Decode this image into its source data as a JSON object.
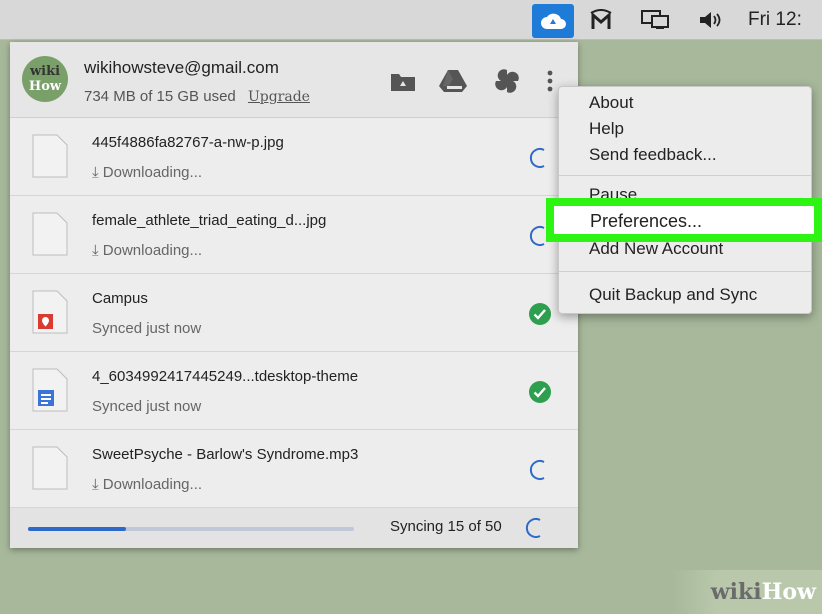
{
  "menubar": {
    "clock": "Fri 12:"
  },
  "account": {
    "avatar_line1": "wiki",
    "avatar_line2": "How",
    "email": "wikihowsteve@gmail.com",
    "usage": "734 MB of 15 GB used",
    "upgrade_label": "Upgrade"
  },
  "files": [
    {
      "name": "445f4886fa82767-a-nw-p.jpg",
      "status": "⤓ Downloading...",
      "state": "syncing"
    },
    {
      "name": "female_athlete_triad_eating_d...jpg",
      "status": "⤓ Downloading...",
      "state": "syncing"
    },
    {
      "name": "Campus",
      "status": "Synced just now",
      "state": "synced"
    },
    {
      "name": "4_6034992417445249...tdesktop-theme",
      "status": "Synced just now",
      "state": "synced"
    },
    {
      "name": "SweetPsyche - Barlow's Syndrome.mp3",
      "status": "⤓ Downloading...",
      "state": "syncing"
    }
  ],
  "footer": {
    "sync_text": "Syncing 15 of 50",
    "progress": 0.3
  },
  "menu": {
    "about": "About",
    "help": "Help",
    "feedback": "Send feedback...",
    "pause": "Pause",
    "preferences": "Preferences...",
    "add_account": "Add New Account",
    "quit": "Quit Backup and Sync"
  },
  "watermark": {
    "wiki": "wiki",
    "how": "How"
  },
  "colors": {
    "accent": "#2e69c9",
    "synced": "#2e9e4f",
    "highlight": "#2ef414"
  }
}
